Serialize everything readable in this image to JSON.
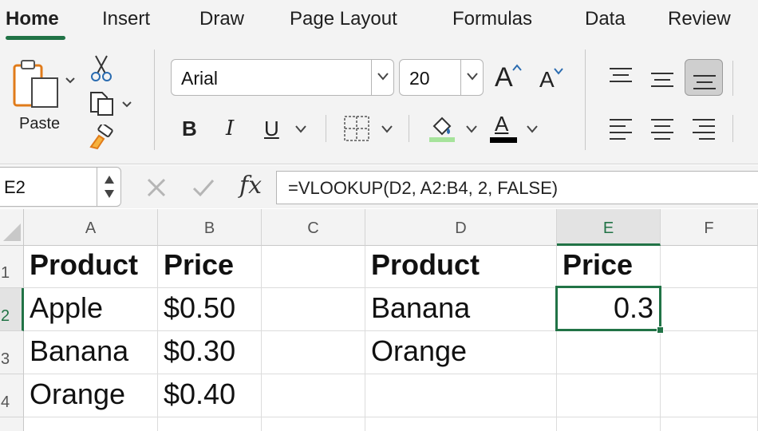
{
  "ribbon_tabs": [
    "Home",
    "Insert",
    "Draw",
    "Page Layout",
    "Formulas",
    "Data",
    "Review"
  ],
  "clipboard": {
    "paste_label": "Paste"
  },
  "font": {
    "name": "Arial",
    "size": "20"
  },
  "format_buttons": {
    "bold": "B",
    "italic": "I",
    "underline": "U",
    "font_color_glyph": "A",
    "grow_glyph": "A",
    "shrink_glyph": "A"
  },
  "colors": {
    "accent": "#217346",
    "highlight": "#a6e39b",
    "font_color": "#000000"
  },
  "formula_bar": {
    "name_box": "E2",
    "fx_label": "fx",
    "formula": "=VLOOKUP(D2, A2:B4, 2, FALSE)"
  },
  "sheet": {
    "columns": [
      "A",
      "B",
      "C",
      "D",
      "E",
      "F"
    ],
    "selected_column": "E",
    "rows": [
      "1",
      "2",
      "3",
      "4"
    ],
    "selected_row": "2",
    "cells": {
      "A1": "Product",
      "B1": "Price",
      "D1": "Product",
      "E1": "Price",
      "A2": "Apple",
      "B2": "$0.50",
      "D2": "Banana",
      "E2": "0.3",
      "A3": "Banana",
      "B3": "$0.30",
      "D3": "Orange",
      "A4": "Orange",
      "B4": "$0.40"
    }
  }
}
